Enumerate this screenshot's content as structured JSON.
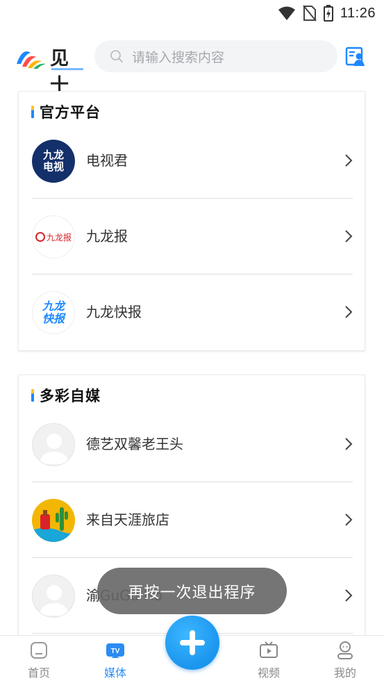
{
  "status_bar": {
    "time": "11:26"
  },
  "header": {
    "logo_text": "见十",
    "search_placeholder": "请输入搜索内容"
  },
  "official_section": {
    "title": "官方平台",
    "items": [
      {
        "label": "电视君",
        "avatar_text_1": "九龙",
        "avatar_text_2": "电视"
      },
      {
        "label": "九龙报",
        "avatar_text": "九龙报"
      },
      {
        "label": "九龙快报",
        "avatar_text_1": "九龙",
        "avatar_text_2": "快报"
      }
    ]
  },
  "media_section": {
    "title": "多彩自媒",
    "items": [
      {
        "label": "德艺双馨老王头"
      },
      {
        "label": "来自天涯旅店"
      },
      {
        "label": "渝GuGu·Ho"
      }
    ]
  },
  "toast": {
    "text": "再按一次退出程序"
  },
  "bottom_nav": {
    "items": [
      {
        "label": "首页",
        "icon": "home-icon",
        "active": false
      },
      {
        "label": "媒体",
        "icon": "tv-icon",
        "active": true
      },
      {
        "label": "视频",
        "icon": "video-icon",
        "active": false
      },
      {
        "label": "我的",
        "icon": "profile-icon",
        "active": false
      }
    ]
  },
  "colors": {
    "accent": "#2b8cf3",
    "title_bar_yellow": "#ffc233",
    "title_bar_blue": "#1e88ff",
    "search_bg": "#f3f4f6",
    "toast_bg": "#666666"
  }
}
